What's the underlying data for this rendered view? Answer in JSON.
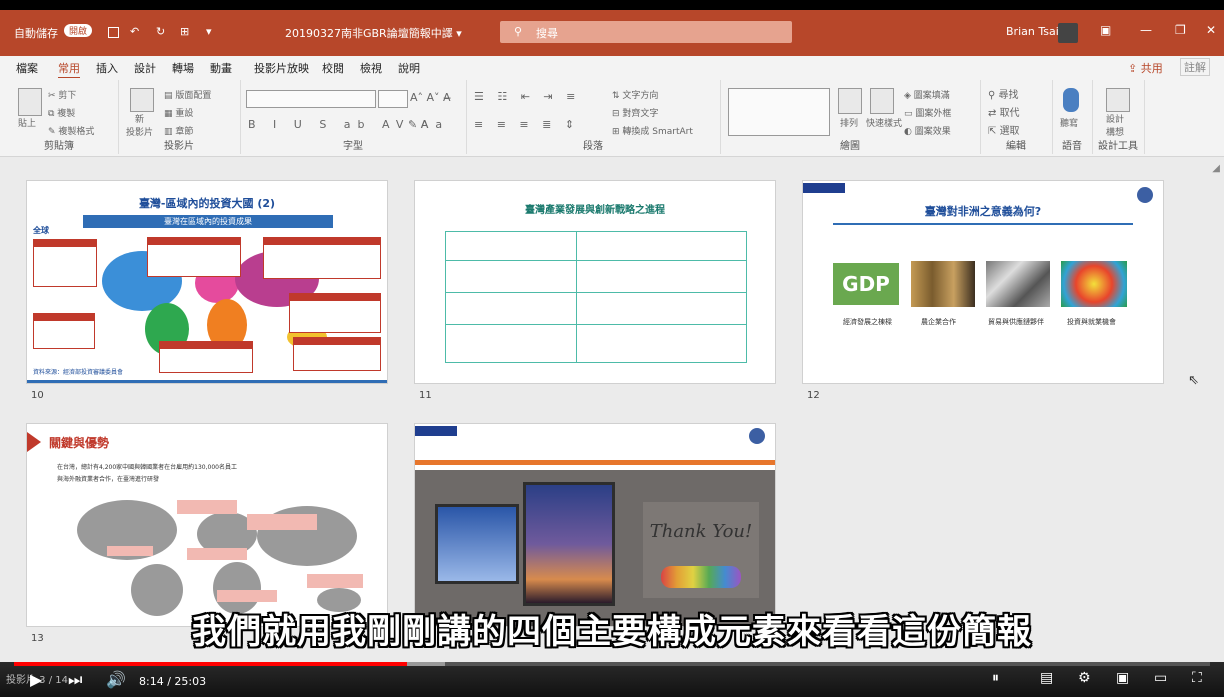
{
  "titlebar": {
    "autosave": "自動儲存",
    "autosave_toggle": "開啟",
    "doc_title": "20190327南非GBR論壇簡報中譯 ▾",
    "search_placeholder": "搜尋",
    "user": "Brian Tsai"
  },
  "menu": {
    "tabs": [
      "檔案",
      "常用",
      "插入",
      "設計",
      "轉場",
      "動畫",
      "投影片放映",
      "校閱",
      "檢視",
      "說明"
    ],
    "active": "常用",
    "share": "共用",
    "comments": "註解"
  },
  "ribbon": {
    "groups": [
      "剪貼簿",
      "投影片",
      "字型",
      "段落",
      "繪圖",
      "編輯",
      "語音",
      "設計工具"
    ],
    "clipboard": {
      "paste": "貼上",
      "cut": "剪下",
      "copy": "複製",
      "format": "複製格式"
    },
    "slides": {
      "new": "新\n投影片",
      "layout": "版面配置",
      "reset": "重設",
      "section": "章節"
    },
    "paragraph": {
      "text_dir": "文字方向",
      "align": "對齊文字",
      "smartart": "轉換成 SmartArt"
    },
    "drawing": {
      "arrange": "排列",
      "quick": "快速樣式",
      "fill": "圖案填滿",
      "outline": "圖案外框",
      "effect": "圖案效果"
    },
    "editing": {
      "find": "尋找",
      "replace": "取代",
      "select": "選取"
    },
    "voice": {
      "dictate": "聽寫"
    },
    "designer": {
      "ideas": "設計\n構想"
    }
  },
  "slides": [
    {
      "num": "10",
      "title": "臺灣-區域內的投資大國 (2)",
      "banner": "臺灣在區域內的投資成果",
      "label_global": "全球",
      "footer": "資料來源：經濟部投資審議委員會"
    },
    {
      "num": "11",
      "title": "臺灣產業發展與創新戰略之進程"
    },
    {
      "num": "12",
      "title": "臺灣對非洲之意義為何?",
      "captions": [
        "經濟發展之棟樑",
        "農企業合作",
        "貿易與供應鏈夥伴",
        "投資與就業機會"
      ]
    },
    {
      "num": "13",
      "title": "關鍵與優勢",
      "bullets": [
        "在台灣，總計有4,200家中國與韓國業者在台雇用約130,000名員工",
        "與海外融資業者合作，在臺灣進行研發"
      ]
    },
    {
      "num": "",
      "title": "Thank You!"
    }
  ],
  "subtitle": "我們就用我剛剛講的四個主要構成元素來看看這份簡報",
  "player": {
    "time": "8:14 / 25:03",
    "status": "投影片 3 / 14",
    "played_fraction": 0.329,
    "buffered_fraction": 0.36
  }
}
